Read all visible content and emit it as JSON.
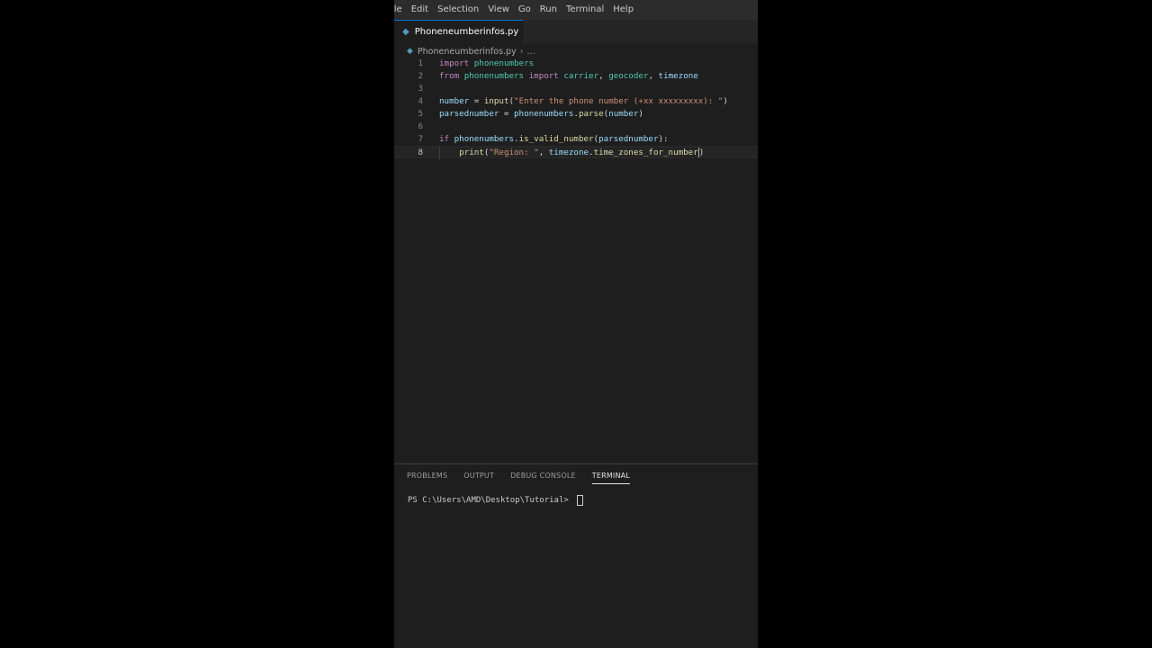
{
  "menu": [
    "File",
    "Edit",
    "Selection",
    "View",
    "Go",
    "Run",
    "Terminal",
    "Help"
  ],
  "menu_visible": [
    "ile",
    "Edit",
    "Selection",
    "View",
    "Go",
    "Run",
    "Terminal",
    "Help"
  ],
  "tab": {
    "filename": "Phoneneumberinfos.py",
    "modified": true
  },
  "breadcrumb": {
    "file": "Phoneneumberinfos.py",
    "more": "..."
  },
  "editor": {
    "lines": [
      {
        "n": "1",
        "tokens": [
          [
            "kw",
            "import"
          ],
          [
            "plain",
            " "
          ],
          [
            "mod",
            "phonenumbers"
          ]
        ]
      },
      {
        "n": "2",
        "tokens": [
          [
            "kw",
            "from"
          ],
          [
            "plain",
            " "
          ],
          [
            "mod",
            "phonenumbers"
          ],
          [
            "plain",
            " "
          ],
          [
            "kw",
            "import"
          ],
          [
            "plain",
            " "
          ],
          [
            "mod",
            "carrier"
          ],
          [
            "plain",
            ", "
          ],
          [
            "mod",
            "geocoder"
          ],
          [
            "plain",
            ", "
          ],
          [
            "var",
            "timezone"
          ]
        ]
      },
      {
        "n": "3",
        "tokens": []
      },
      {
        "n": "4",
        "tokens": [
          [
            "var",
            "number"
          ],
          [
            "plain",
            " = "
          ],
          [
            "fn",
            "input"
          ],
          [
            "plain",
            "("
          ],
          [
            "str",
            "\"Enter the phone number (+xx xxxxxxxxx): \""
          ],
          [
            "plain",
            ")"
          ]
        ]
      },
      {
        "n": "5",
        "tokens": [
          [
            "var",
            "parsednumber"
          ],
          [
            "plain",
            " = "
          ],
          [
            "var",
            "phonenumbers"
          ],
          [
            "plain",
            "."
          ],
          [
            "fn",
            "parse"
          ],
          [
            "plain",
            "("
          ],
          [
            "var",
            "number"
          ],
          [
            "plain",
            ")"
          ]
        ]
      },
      {
        "n": "6",
        "tokens": []
      },
      {
        "n": "7",
        "tokens": [
          [
            "kw2",
            "if"
          ],
          [
            "plain",
            " "
          ],
          [
            "var",
            "phonenumbers"
          ],
          [
            "plain",
            "."
          ],
          [
            "fn",
            "is_valid_number"
          ],
          [
            "plain",
            "("
          ],
          [
            "var",
            "parsednumber"
          ],
          [
            "plain",
            "):"
          ]
        ]
      },
      {
        "n": "8",
        "tokens": [
          [
            "plain",
            "    "
          ],
          [
            "fn",
            "print"
          ],
          [
            "plain",
            "("
          ],
          [
            "str",
            "\"Region: \""
          ],
          [
            "plain",
            ", "
          ],
          [
            "var",
            "timezone"
          ],
          [
            "plain",
            "."
          ],
          [
            "fn",
            "time_zones_for_number"
          ],
          [
            "plain",
            ")"
          ]
        ]
      }
    ],
    "active_line": "8"
  },
  "panel": {
    "tabs": [
      "PROBLEMS",
      "OUTPUT",
      "DEBUG CONSOLE",
      "TERMINAL"
    ],
    "active_tab": "TERMINAL",
    "prompt": "PS C:\\Users\\AMD\\Desktop\\Tutorial> "
  },
  "colors": {
    "keyword": "#c586c0",
    "module": "#4ec9b0",
    "variable": "#9cdcfe",
    "function": "#dcdcaa",
    "string": "#ce9178",
    "editor_bg": "#1e1e1e"
  }
}
